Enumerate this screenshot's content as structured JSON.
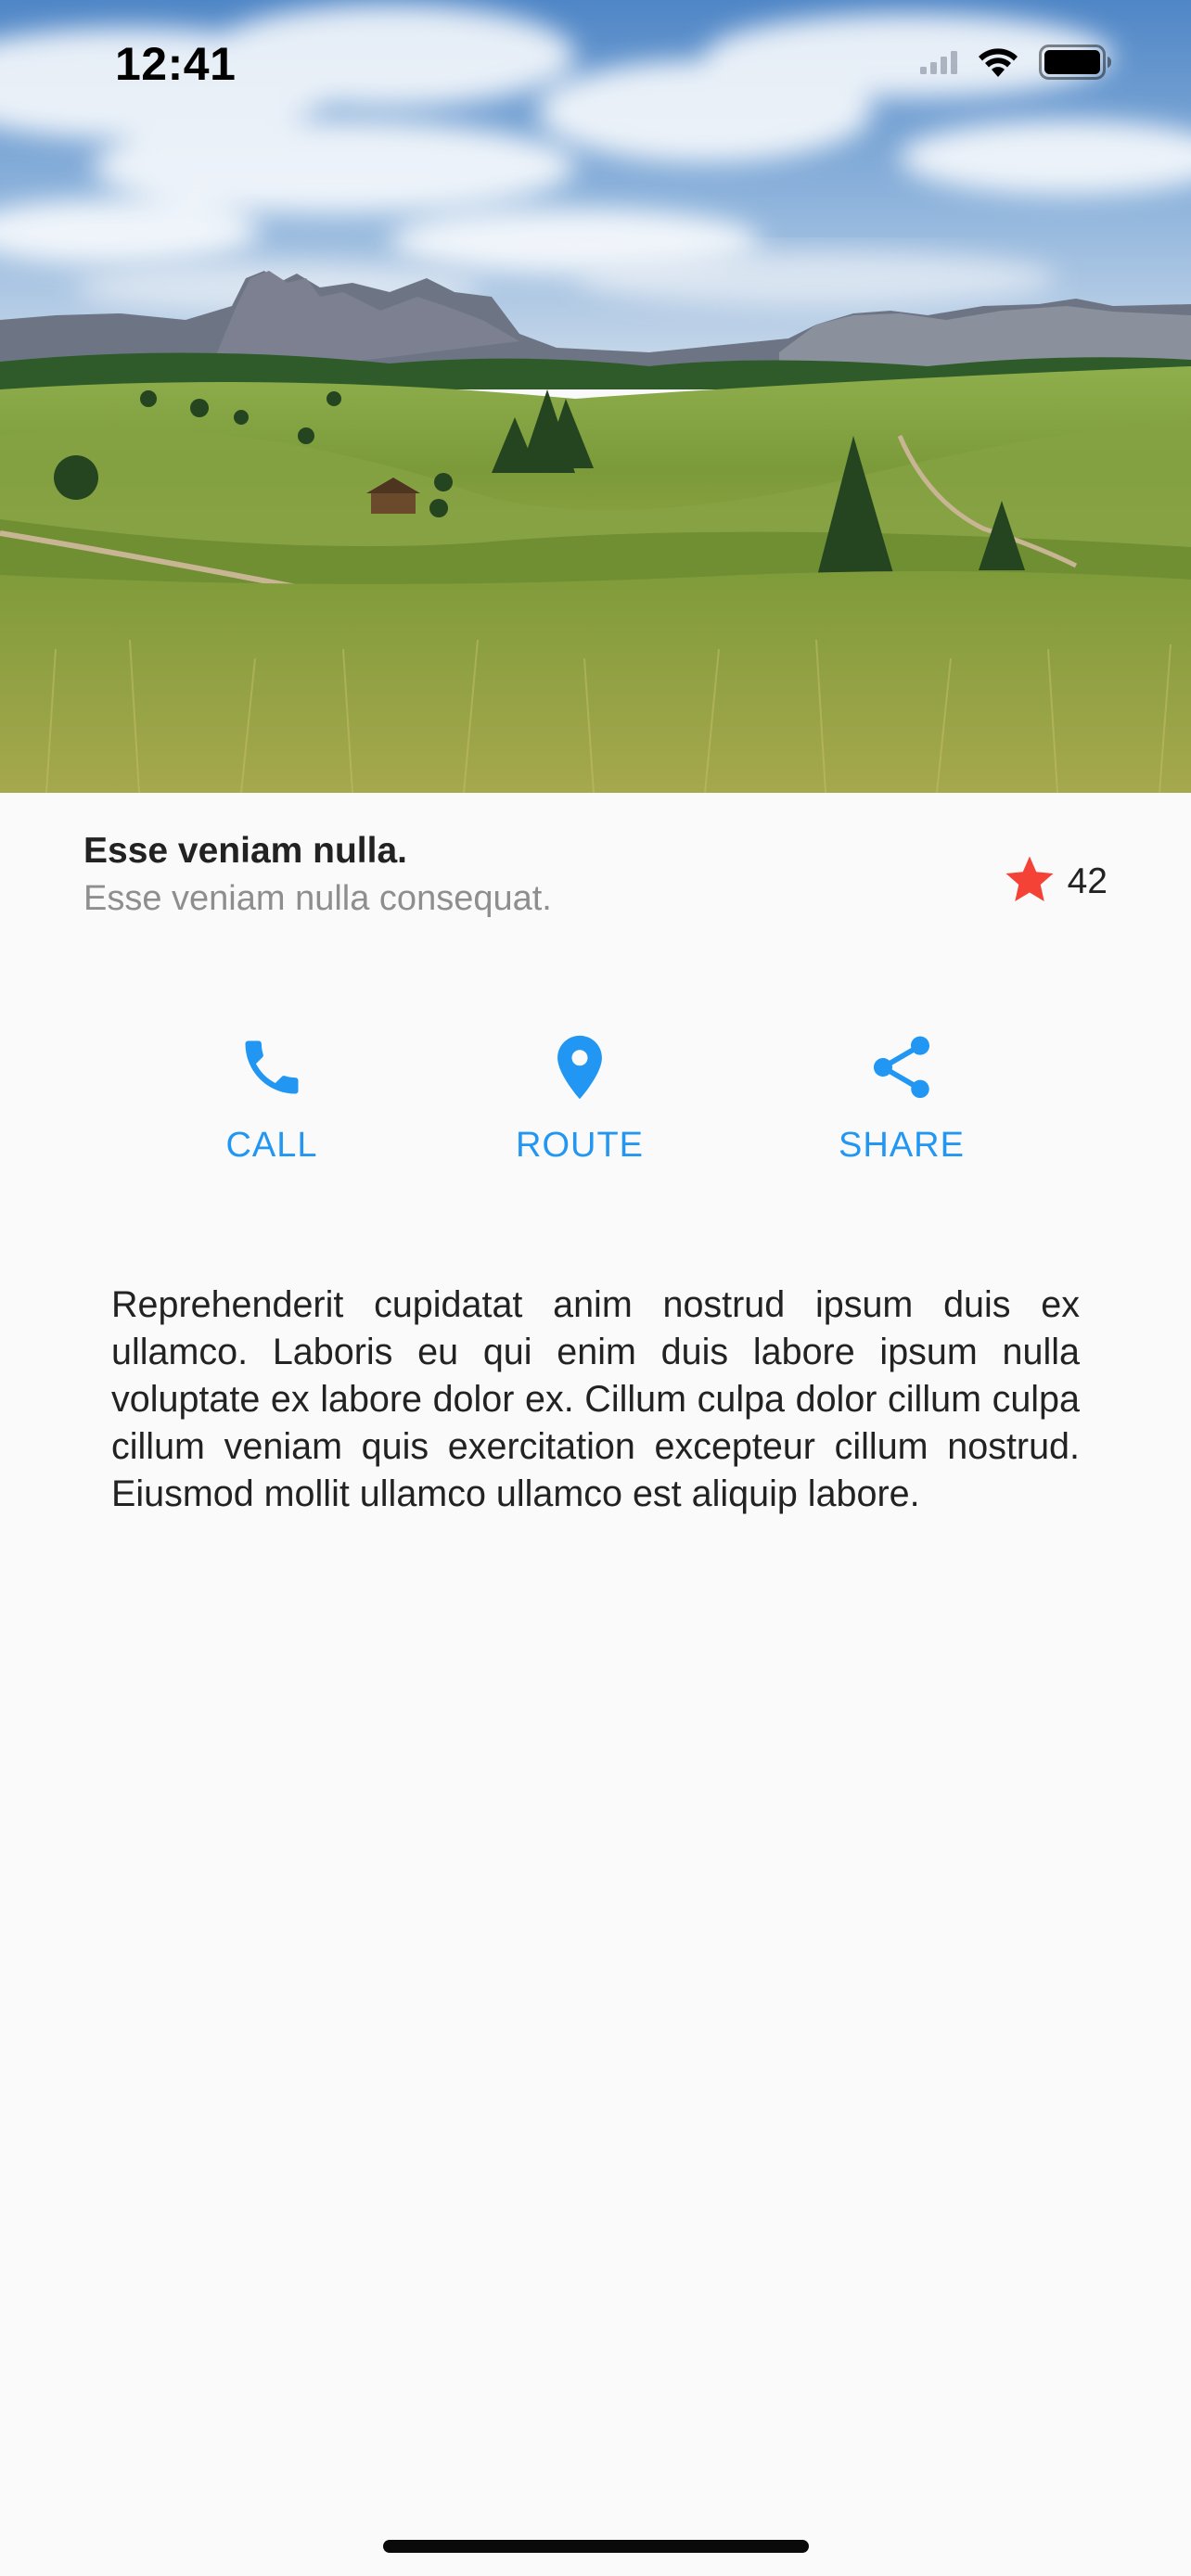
{
  "status_bar": {
    "time": "12:41",
    "icons": [
      "signal-icon",
      "wifi-icon",
      "battery-icon"
    ]
  },
  "hero": {
    "image": "mountain-meadow-landscape"
  },
  "place": {
    "title": "Esse veniam nulla.",
    "subtitle": "Esse veniam nulla consequat.",
    "rating": {
      "icon": "star-icon",
      "color": "#f44336",
      "count": "42"
    }
  },
  "actions": {
    "color": "#2196f3",
    "call": {
      "label": "CALL",
      "icon": "phone-icon"
    },
    "route": {
      "label": "ROUTE",
      "icon": "location-pin-icon"
    },
    "share": {
      "label": "SHARE",
      "icon": "share-icon"
    }
  },
  "description": "Reprehenderit cupidatat anim nostrud ipsum duis ex ullamco. Laboris eu qui enim duis labore ipsum nulla voluptate ex labore dolor ex. Cillum culpa dolor cillum culpa cillum veniam quis exercitation excepteur cillum nostrud. Eiusmod mollit ullamco ullamco est aliquip labore."
}
